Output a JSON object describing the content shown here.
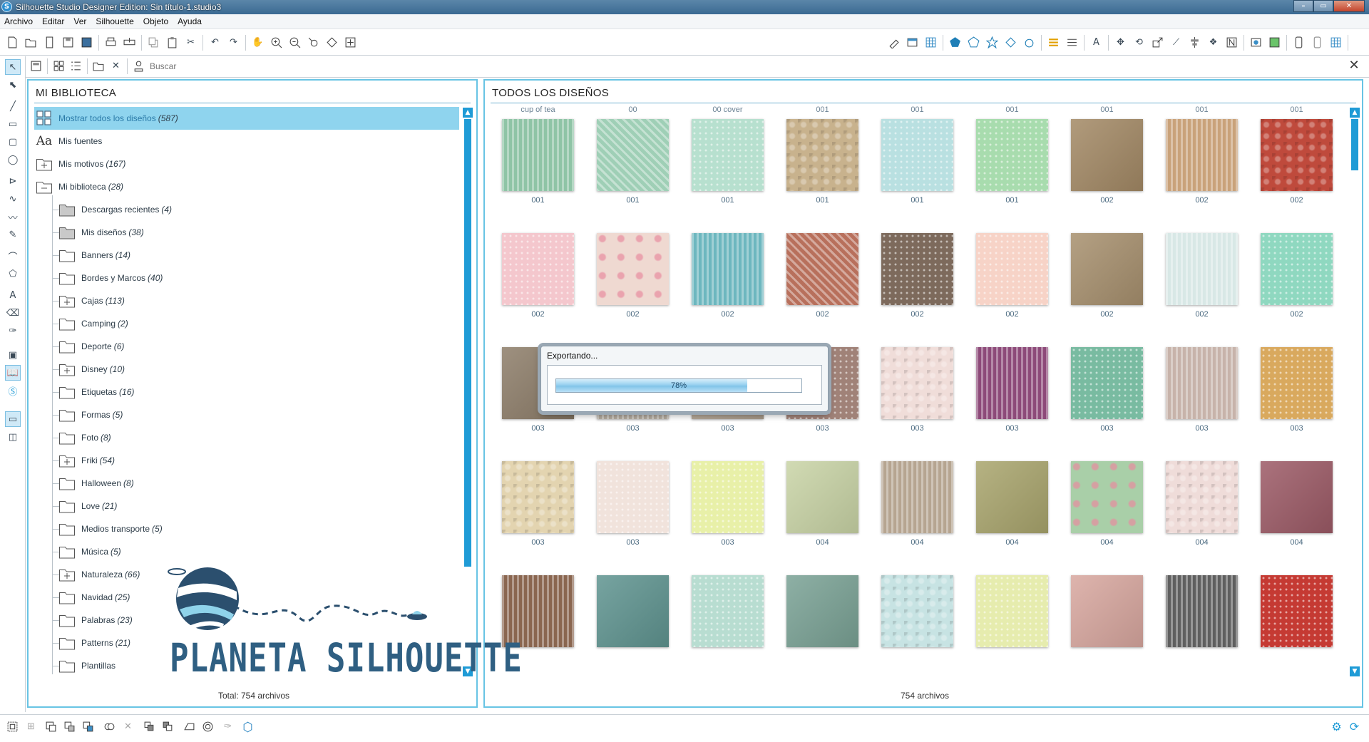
{
  "window": {
    "title": "Silhouette Studio Designer Edition: Sin título-1.studio3",
    "logo": "S"
  },
  "menu": [
    "Archivo",
    "Editar",
    "Ver",
    "Silhouette",
    "Objeto",
    "Ayuda"
  ],
  "search": {
    "placeholder": "Buscar"
  },
  "library": {
    "title": "MI BIBLIOTECA",
    "items": [
      {
        "label": "Mostrar todos los diseños",
        "count": "(587)",
        "icon": "grid-icon",
        "selected": true
      },
      {
        "label": "Mis fuentes",
        "count": "",
        "icon": "font-icon"
      },
      {
        "label": "Mis motivos",
        "count": "(167)",
        "icon": "folder-plus-icon"
      },
      {
        "label": "Mi biblioteca",
        "count": "(28)",
        "icon": "folder-minus-icon"
      }
    ],
    "folders": [
      {
        "label": "Descargas recientes",
        "count": "(4)",
        "icon": "folder-filled-icon"
      },
      {
        "label": "Mis diseños",
        "count": "(38)",
        "icon": "folder-filled-icon"
      },
      {
        "label": "Banners",
        "count": "(14)",
        "icon": "folder-icon"
      },
      {
        "label": "Bordes y Marcos",
        "count": "(40)",
        "icon": "folder-icon"
      },
      {
        "label": "Cajas",
        "count": "(113)",
        "icon": "folder-plus-icon"
      },
      {
        "label": "Camping",
        "count": "(2)",
        "icon": "folder-icon"
      },
      {
        "label": "Deporte",
        "count": "(6)",
        "icon": "folder-icon"
      },
      {
        "label": "Disney",
        "count": "(10)",
        "icon": "folder-plus-icon"
      },
      {
        "label": "Etiquetas",
        "count": "(16)",
        "icon": "folder-icon"
      },
      {
        "label": "Formas",
        "count": "(5)",
        "icon": "folder-icon"
      },
      {
        "label": "Foto",
        "count": "(8)",
        "icon": "folder-icon"
      },
      {
        "label": "Friki",
        "count": "(54)",
        "icon": "folder-plus-icon"
      },
      {
        "label": "Halloween",
        "count": "(8)",
        "icon": "folder-icon"
      },
      {
        "label": "Love",
        "count": "(21)",
        "icon": "folder-icon"
      },
      {
        "label": "Medios transporte",
        "count": "(5)",
        "icon": "folder-icon"
      },
      {
        "label": "Música",
        "count": "(5)",
        "icon": "folder-icon"
      },
      {
        "label": "Naturaleza",
        "count": "(66)",
        "icon": "folder-plus-icon"
      },
      {
        "label": "Navidad",
        "count": "(25)",
        "icon": "folder-icon"
      },
      {
        "label": "Palabras",
        "count": "(23)",
        "icon": "folder-icon"
      },
      {
        "label": "Patterns",
        "count": "(21)",
        "icon": "folder-icon"
      },
      {
        "label": "Plantillas",
        "count": "",
        "icon": "folder-icon"
      }
    ],
    "total": "Total: 754 archivos"
  },
  "designs": {
    "title": "TODOS LOS DISEÑOS",
    "top_labels": [
      "cup of tea",
      "00",
      "00 cover",
      "001",
      "001",
      "001",
      "001",
      "001",
      "001"
    ],
    "rows": [
      [
        {
          "l": "001",
          "c": "#8fc4a6",
          "p": "stripes"
        },
        {
          "l": "001",
          "c": "#9fcfb6",
          "p": "diag"
        },
        {
          "l": "001",
          "c": "#b7e0cf",
          "p": "dots"
        },
        {
          "l": "001",
          "c": "#c8b28d",
          "p": "damask"
        },
        {
          "l": "001",
          "c": "#b9e0e1",
          "p": "dots"
        },
        {
          "l": "001",
          "c": "#a8dcae",
          "p": "dots"
        },
        {
          "l": "002",
          "c": "#a38965",
          "p": "plain"
        },
        {
          "l": "002",
          "c": "#c9a27a",
          "p": "stripes"
        },
        {
          "l": "002",
          "c": "#bf4a3c",
          "p": "damask"
        }
      ],
      [
        {
          "l": "002",
          "c": "#f4c7cd",
          "p": "dots"
        },
        {
          "l": "002",
          "c": "#efd9d1",
          "p": "flower"
        },
        {
          "l": "002",
          "c": "#6db7bf",
          "p": "stripes"
        },
        {
          "l": "002",
          "c": "#b8705c",
          "p": "diag"
        },
        {
          "l": "002",
          "c": "#7d6a5c",
          "p": "dots"
        },
        {
          "l": "002",
          "c": "#f7d3c7",
          "p": "dots"
        },
        {
          "l": "002",
          "c": "#a7906e",
          "p": "plain"
        },
        {
          "l": "002",
          "c": "#d8e8e6",
          "p": "stripes"
        },
        {
          "l": "002",
          "c": "#8fd8c0",
          "p": "dots"
        }
      ],
      [
        {
          "l": "003",
          "c": "#8d7d69",
          "p": "plain"
        },
        {
          "l": "003",
          "c": "#b1a99d",
          "p": "stripes"
        },
        {
          "l": "003",
          "c": "#b9aa98",
          "p": "plain"
        },
        {
          "l": "003",
          "c": "#a08278",
          "p": "dots"
        },
        {
          "l": "003",
          "c": "#f0ddd9",
          "p": "damask"
        },
        {
          "l": "003",
          "c": "#8d4a79",
          "p": "stripes"
        },
        {
          "l": "003",
          "c": "#79bba1",
          "p": "dots"
        },
        {
          "l": "003",
          "c": "#c7b3aa",
          "p": "stripes"
        },
        {
          "l": "003",
          "c": "#d9a95e",
          "p": "dots"
        }
      ],
      [
        {
          "l": "003",
          "c": "#e3d4b0",
          "p": "damask"
        },
        {
          "l": "003",
          "c": "#f1e3dc",
          "p": "dots"
        },
        {
          "l": "003",
          "c": "#e8f0a8",
          "p": "dots"
        },
        {
          "l": "004",
          "c": "#c9d4a6",
          "p": "plain"
        },
        {
          "l": "004",
          "c": "#b6a591",
          "p": "stripes"
        },
        {
          "l": "004",
          "c": "#a9a56d",
          "p": "plain"
        },
        {
          "l": "004",
          "c": "#a9cfa8",
          "p": "flower"
        },
        {
          "l": "004",
          "c": "#efdcd9",
          "p": "damask"
        },
        {
          "l": "004",
          "c": "#9c5a66",
          "p": "plain"
        }
      ],
      [
        {
          "l": "",
          "c": "#8a6650",
          "p": "stripes"
        },
        {
          "l": "",
          "c": "#5f9490",
          "p": "plain"
        },
        {
          "l": "",
          "c": "#b8ddd1",
          "p": "dots"
        },
        {
          "l": "",
          "c": "#7aa295",
          "p": "plain"
        },
        {
          "l": "",
          "c": "#c7e3e3",
          "p": "damask"
        },
        {
          "l": "",
          "c": "#e6ecae",
          "p": "dots"
        },
        {
          "l": "",
          "c": "#d8a79f",
          "p": "plain"
        },
        {
          "l": "",
          "c": "#5f5f5f",
          "p": "stripes"
        },
        {
          "l": "",
          "c": "#c53a33",
          "p": "dots"
        }
      ]
    ],
    "total": "754 archivos"
  },
  "dialog": {
    "title": "Exportando...",
    "progress": 78,
    "progress_text": "78%"
  },
  "watermark": {
    "text": "PLANETA SILHOUETTE"
  },
  "colors": {
    "accent": "#1f9bd6",
    "selected_row": "#8fd4ee",
    "panel_border": "#68c4e4"
  }
}
